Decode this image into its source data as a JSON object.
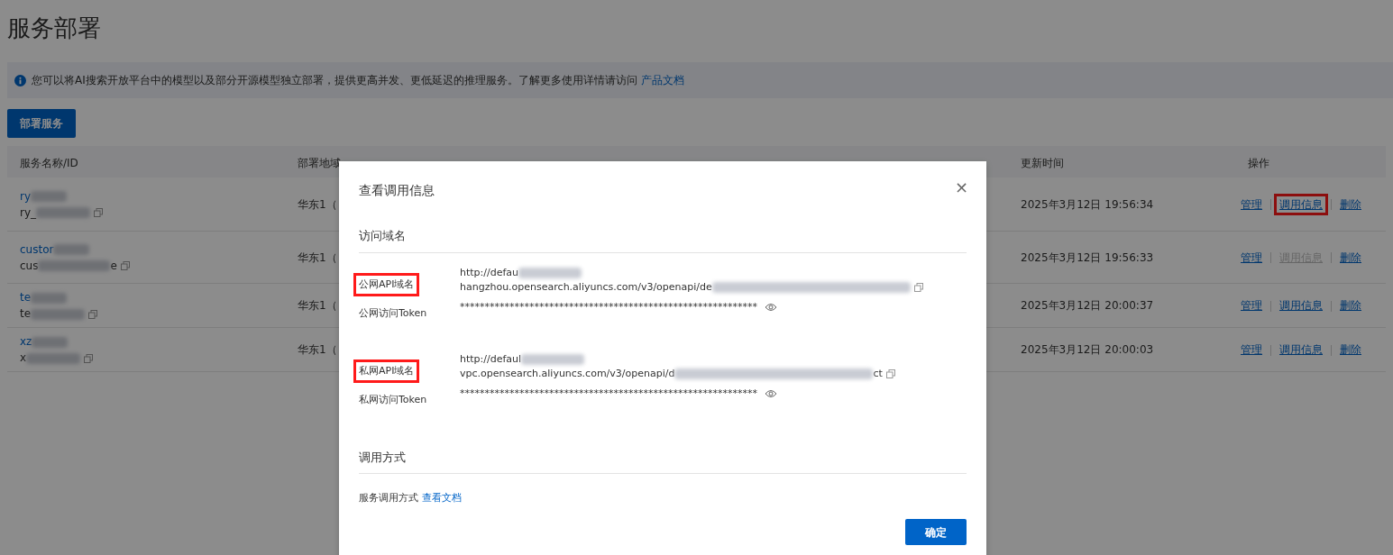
{
  "page": {
    "title": "服务部署"
  },
  "notice": {
    "text": "您可以将AI搜索开放平台中的模型以及部分开源模型独立部署，提供更高并发、更低延迟的推理服务。了解更多使用详情请访问",
    "link": "产品文档"
  },
  "primary_button": "部署服务",
  "table": {
    "columns": [
      "服务名称/ID",
      "部署地域",
      "更新时间",
      "操作"
    ],
    "rows": [
      {
        "name": "ry",
        "id": "ry_",
        "region": "华东1（",
        "updated": "2025年3月12日 19:56:34",
        "actions": [
          {
            "label": "管理",
            "disabled": false,
            "highlighted": false
          },
          {
            "label": "调用信息",
            "disabled": false,
            "highlighted": true
          },
          {
            "label": "删除",
            "disabled": false,
            "highlighted": false
          }
        ]
      },
      {
        "name": "custor",
        "id": "cus",
        "id_suffix": "e",
        "region": "华东1（",
        "updated": "2025年3月12日 19:56:33",
        "actions": [
          {
            "label": "管理",
            "disabled": false,
            "highlighted": false
          },
          {
            "label": "调用信息",
            "disabled": true,
            "highlighted": false
          },
          {
            "label": "删除",
            "disabled": false,
            "highlighted": false
          }
        ]
      },
      {
        "name": "te",
        "id": "te",
        "region": "华东1（",
        "updated": "2025年3月12日 20:00:37",
        "actions": [
          {
            "label": "管理",
            "disabled": false,
            "highlighted": false
          },
          {
            "label": "调用信息",
            "disabled": false,
            "highlighted": false
          },
          {
            "label": "删除",
            "disabled": false,
            "highlighted": false
          }
        ]
      },
      {
        "name": "xz",
        "id": "x",
        "region": "华东1（",
        "updated": "2025年3月12日 20:00:03",
        "actions": [
          {
            "label": "管理",
            "disabled": false,
            "highlighted": false
          },
          {
            "label": "调用信息",
            "disabled": false,
            "highlighted": false
          },
          {
            "label": "删除",
            "disabled": false,
            "highlighted": false
          }
        ]
      }
    ]
  },
  "dialog": {
    "title": "查看调用信息",
    "close": "×",
    "sections": [
      {
        "heading": "访问域名",
        "fields": [
          {
            "kind": "url",
            "label": "公网API域名",
            "highlighted": true,
            "lines": [
              {
                "text": "http://defau",
                "copyable": false
              },
              {
                "text": "hangzhou.opensearch.aliyuncs.com/v3/openapi/de",
                "copyable": true
              }
            ]
          },
          {
            "kind": "token",
            "label": "公网访问Token",
            "highlighted": false,
            "value": "************************************************************"
          },
          {
            "kind": "url",
            "label": "私网API域名",
            "highlighted": true,
            "lines": [
              {
                "text": "http://defaul",
                "copyable": false
              },
              {
                "text": "vpc.opensearch.aliyuncs.com/v3/openapi/d",
                "suffix": "ct",
                "copyable": true
              }
            ]
          },
          {
            "kind": "token",
            "label": "私网访问Token",
            "highlighted": false,
            "value": "************************************************************"
          }
        ]
      },
      {
        "heading": "调用方式",
        "fields": [
          {
            "kind": "doc",
            "label": "服务调用方式",
            "link": "查看文档",
            "highlighted": false
          }
        ]
      }
    ],
    "confirm": "确定"
  }
}
